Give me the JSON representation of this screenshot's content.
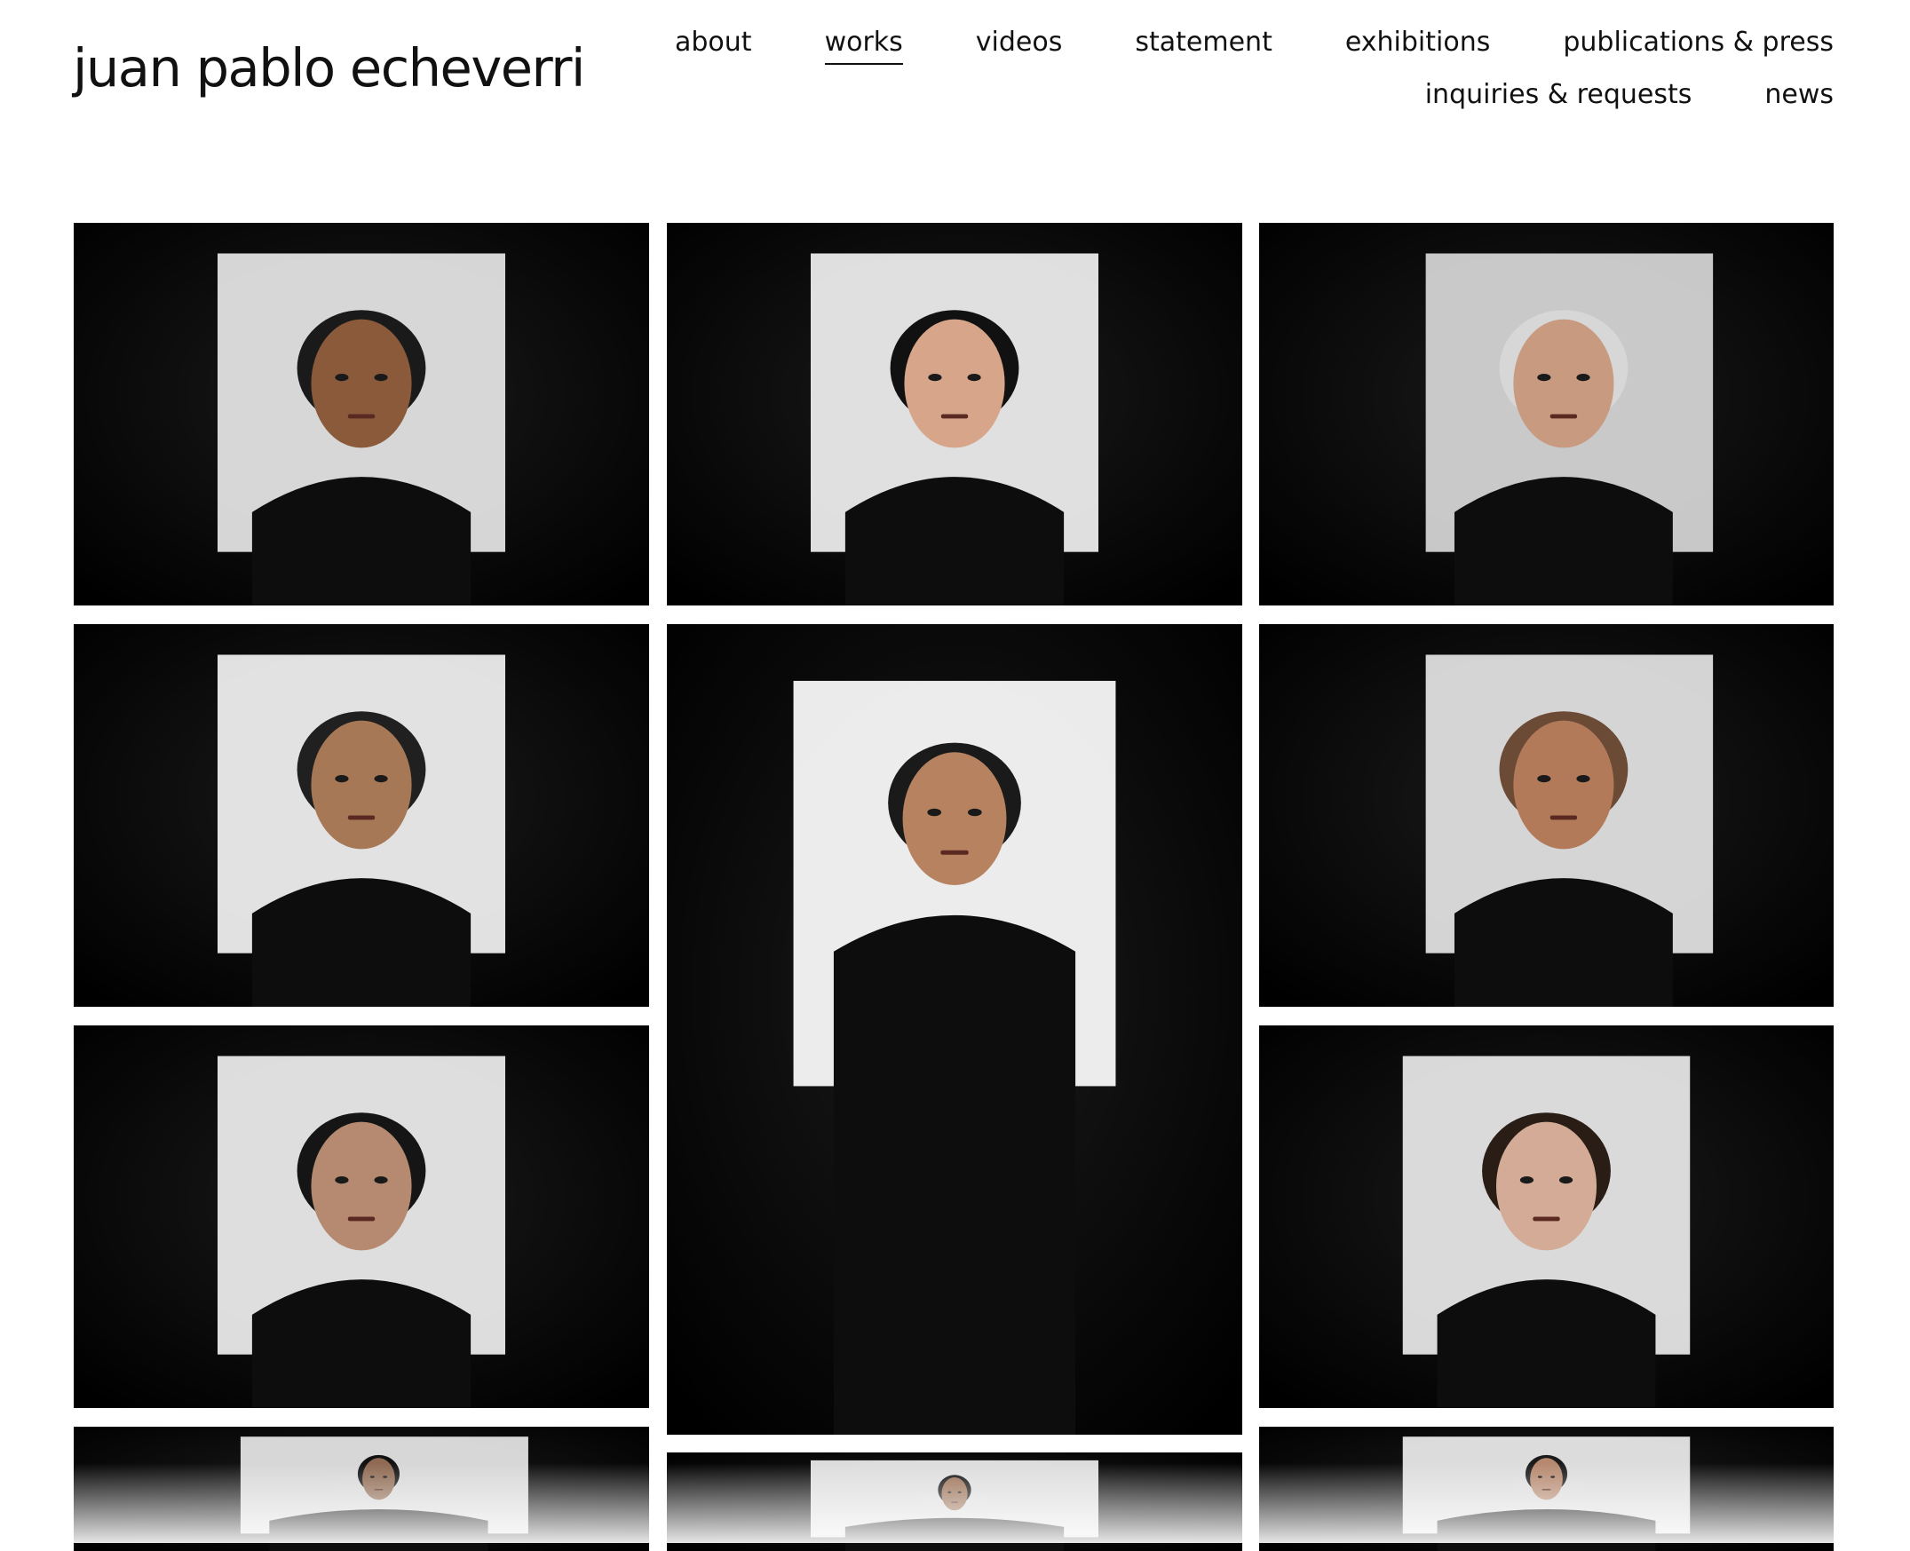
{
  "site": {
    "title": "juan pablo echeverri"
  },
  "nav": {
    "row1": [
      "about",
      "works",
      "videos",
      "statement",
      "exhibitions",
      "publications & press"
    ],
    "row2": [
      "inquiries & requests",
      "news"
    ],
    "active": "works"
  },
  "gallery": {
    "tiles": [
      {
        "name": "portrait-cap-chain",
        "skin": "#8a5a3a",
        "hair": "#1a1a1a",
        "screen": "#e8e8e8"
      },
      {
        "name": "portrait-headband-woman",
        "skin": "#d6a58a",
        "hair": "#111111",
        "screen": "#f2f2f2"
      },
      {
        "name": "portrait-silver-hair-man",
        "skin": "#c89a80",
        "hair": "#d7d7d7",
        "screen": "#d9d9d9"
      },
      {
        "name": "portrait-bob-wig-woman",
        "skin": "#a77856",
        "hair": "#202020",
        "screen": "#f4f4f4"
      },
      {
        "name": "portrait-dreadlocks-man",
        "skin": "#b7825f",
        "hair": "#1a1a1a",
        "screen": "#ffffff"
      },
      {
        "name": "portrait-curly-woman",
        "skin": "#b37a5a",
        "hair": "#6b4a36",
        "screen": "#e6e6e6"
      },
      {
        "name": "portrait-beret-man",
        "skin": "#b58a70",
        "hair": "#151515",
        "screen": "#f0f0f0"
      },
      {
        "name": "portrait-young-man",
        "skin": "#d4ab96",
        "hair": "#2a1d16",
        "screen": "#ececec"
      },
      {
        "name": "portrait-partial-1",
        "skin": "#8f6a52",
        "hair": "#111111",
        "screen": "#e8e8e8"
      },
      {
        "name": "portrait-partial-2",
        "skin": "#9a7055",
        "hair": "#111111",
        "screen": "#efefef"
      },
      {
        "name": "portrait-partial-3",
        "skin": "#b6896f",
        "hair": "#1a1a1a",
        "screen": "#eeeeee"
      }
    ]
  }
}
